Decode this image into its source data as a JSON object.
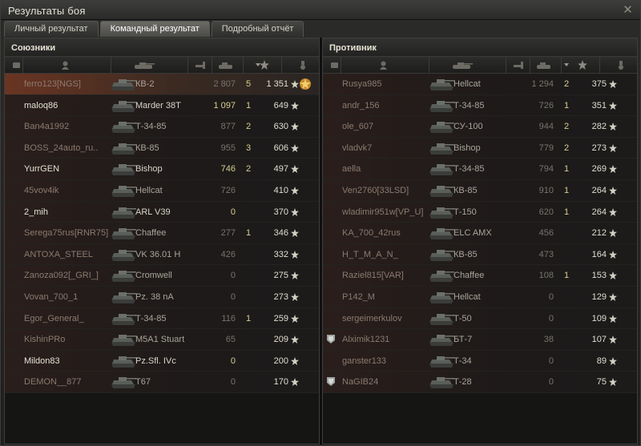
{
  "window": {
    "title": "Результаты боя",
    "close_label": "✕"
  },
  "tabs": [
    {
      "label": "Личный результат",
      "active": false
    },
    {
      "label": "Командный результат",
      "active": true
    },
    {
      "label": "Подробный отчёт",
      "active": false
    }
  ],
  "allies": {
    "title": "Союзники",
    "columns": [
      "platoon-icon",
      "player-icon",
      "tank-icon",
      "damage-icon",
      "kills-icon",
      "xp-icon",
      "medal-icon"
    ],
    "rows": [
      {
        "name": "ferro123[NGS]",
        "vehicle": "КВ-2",
        "damage": "2 807",
        "kills": "5",
        "xp": "1 351",
        "alive": false,
        "highlight": true,
        "medal": true,
        "dmg_bright": false
      },
      {
        "name": "maloq86",
        "vehicle": "Marder 38T",
        "damage": "1 097",
        "kills": "1",
        "xp": "649",
        "alive": true,
        "dmg_bright": true
      },
      {
        "name": "Ban4a1992",
        "vehicle": "Т-34-85",
        "damage": "877",
        "kills": "2",
        "xp": "630",
        "alive": false
      },
      {
        "name": "BOSS_24auto_ru..",
        "vehicle": "КВ-85",
        "damage": "955",
        "kills": "3",
        "xp": "606",
        "alive": false
      },
      {
        "name": "YurrGEN",
        "vehicle": "Bishop",
        "damage": "746",
        "kills": "2",
        "xp": "497",
        "alive": true,
        "dmg_bright": true
      },
      {
        "name": "45vov4ik",
        "vehicle": "Hellcat",
        "damage": "726",
        "kills": "",
        "xp": "410",
        "alive": false
      },
      {
        "name": "2_mih",
        "vehicle": "ARL V39",
        "damage": "0",
        "kills": "",
        "xp": "370",
        "alive": true,
        "dmg_bright": true
      },
      {
        "name": "Serega75rus[RNR75]",
        "vehicle": "Chaffee",
        "damage": "277",
        "kills": "1",
        "xp": "346",
        "alive": false
      },
      {
        "name": "ANTOXA_STEEL",
        "vehicle": "VK 36.01 H",
        "damage": "426",
        "kills": "",
        "xp": "332",
        "alive": false
      },
      {
        "name": "Zanoza092[_GRI_]",
        "vehicle": "Cromwell",
        "damage": "0",
        "kills": "",
        "xp": "275",
        "alive": false
      },
      {
        "name": "Vovan_700_1",
        "vehicle": "Pz. 38 nA",
        "damage": "0",
        "kills": "",
        "xp": "273",
        "alive": false
      },
      {
        "name": "Egor_General_",
        "vehicle": "Т-34-85",
        "damage": "116",
        "kills": "1",
        "xp": "259",
        "alive": false
      },
      {
        "name": "KishinPRo",
        "vehicle": "M5A1 Stuart",
        "damage": "65",
        "kills": "",
        "xp": "209",
        "alive": false
      },
      {
        "name": "Mildon83",
        "vehicle": "Pz.Sfl. IVc",
        "damage": "0",
        "kills": "",
        "xp": "200",
        "alive": true,
        "dmg_bright": true
      },
      {
        "name": "DEMON__877",
        "vehicle": "T67",
        "damage": "0",
        "kills": "",
        "xp": "170",
        "alive": false
      }
    ]
  },
  "enemies": {
    "title": "Противник",
    "rows": [
      {
        "name": "Rusya985",
        "vehicle": "Hellcat",
        "damage": "1 294",
        "kills": "2",
        "xp": "375"
      },
      {
        "name": "andr_156",
        "vehicle": "Т-34-85",
        "damage": "726",
        "kills": "1",
        "xp": "351"
      },
      {
        "name": "ole_607",
        "vehicle": "СУ-100",
        "damage": "944",
        "kills": "2",
        "xp": "282"
      },
      {
        "name": "vladvk7",
        "vehicle": "Bishop",
        "damage": "779",
        "kills": "2",
        "xp": "273"
      },
      {
        "name": "aella",
        "vehicle": "Т-34-85",
        "damage": "794",
        "kills": "1",
        "xp": "269"
      },
      {
        "name": "Ven2760[33LSD]",
        "vehicle": "КВ-85",
        "damage": "910",
        "kills": "1",
        "xp": "264"
      },
      {
        "name": "wladimir951w[VP_U]",
        "vehicle": "Т-150",
        "damage": "620",
        "kills": "1",
        "xp": "264"
      },
      {
        "name": "KA_700_42rus",
        "vehicle": "ELC AMX",
        "damage": "456",
        "kills": "",
        "xp": "212"
      },
      {
        "name": "H_T_M_A_N_",
        "vehicle": "КВ-85",
        "damage": "473",
        "kills": "",
        "xp": "164"
      },
      {
        "name": "Raziel815[VAR]",
        "vehicle": "Chaffee",
        "damage": "108",
        "kills": "1",
        "xp": "153"
      },
      {
        "name": "P142_M",
        "vehicle": "Hellcat",
        "damage": "0",
        "kills": "",
        "xp": "129"
      },
      {
        "name": "sergeimerkulov",
        "vehicle": "Т-50",
        "damage": "0",
        "kills": "",
        "xp": "109"
      },
      {
        "name": "Alximik1231",
        "vehicle": "БТ-7",
        "damage": "38",
        "kills": "",
        "xp": "107",
        "badge": true
      },
      {
        "name": "ganster133",
        "vehicle": "Т-34",
        "damage": "0",
        "kills": "",
        "xp": "89"
      },
      {
        "name": "NaGIB24",
        "vehicle": "Т-28",
        "damage": "0",
        "kills": "",
        "xp": "75",
        "badge": true
      }
    ]
  },
  "colors": {
    "highlight": "#6a3522",
    "text": "#e4e1d4",
    "dead": "#8c7a70"
  }
}
